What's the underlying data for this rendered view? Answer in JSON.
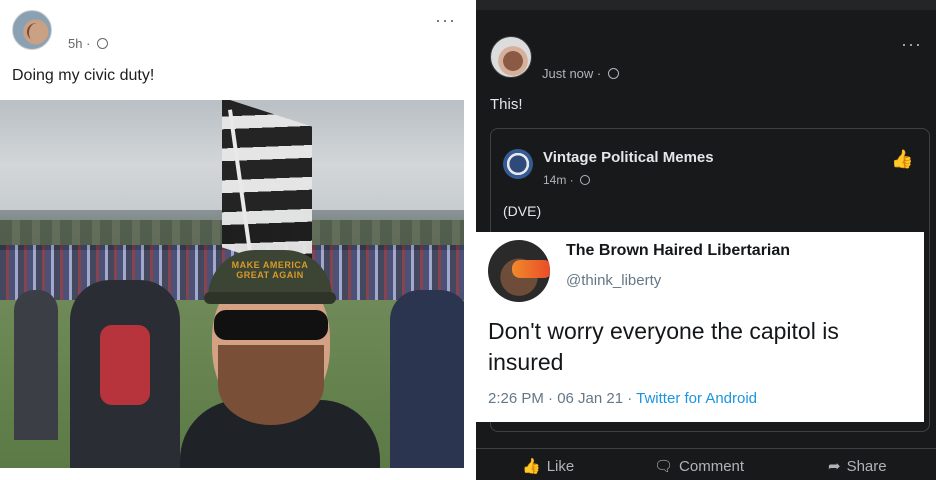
{
  "left_post": {
    "time": "5h ·",
    "caption": "Doing my civic duty!",
    "more_label": "···",
    "photo": {
      "cap_text": "MAKE AMERICA GREAT AGAIN"
    }
  },
  "right_post": {
    "time": "Just now ·",
    "caption": "This!",
    "more_label": "···",
    "shared": {
      "page_name": "Vintage Political Memes",
      "page_time": "14m ·",
      "text": "(DVE)"
    },
    "tweet": {
      "name": "The Brown Haired Libertarian",
      "handle": "@think_liberty",
      "text": "Don't worry everyone the capitol is insured",
      "timestamp": "2:26 PM · 06 Jan 21 · ",
      "app": "Twitter for Android"
    },
    "actions": {
      "like": "Like",
      "comment": "Comment",
      "share": "Share"
    }
  },
  "icons": {
    "globe": "globe-icon",
    "like": "thumbs-up-icon",
    "comment": "comment-icon",
    "share": "share-icon"
  },
  "colors": {
    "dark_bg": "#18191a",
    "twitter_link": "#1b95e0"
  }
}
